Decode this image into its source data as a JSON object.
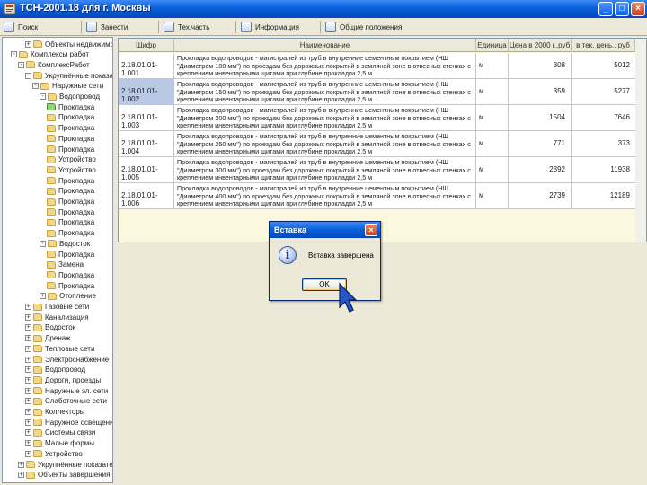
{
  "window": {
    "title": "ТСН-2001.18 для г. Москвы",
    "minimize": "_",
    "maximize": "□",
    "close": "×"
  },
  "toolbar": {
    "buttons": [
      "Поиск",
      "Занести",
      "Тех.часть",
      "Информация",
      "Общие положения"
    ]
  },
  "tree": {
    "items": [
      {
        "exp": "+",
        "label": "Объекты недвижимости"
      },
      {
        "exp": "-",
        "label": "Комплексы работ"
      },
      {
        "exp": "-",
        "label": "КомплексРабот"
      },
      {
        "exp": "-",
        "label": "Укрупнённые показатели"
      },
      {
        "exp": "-",
        "label": "Наружные сети"
      },
      {
        "exp": "-",
        "label": "Водопровод"
      },
      {
        "exp": "",
        "label": "Прокладка"
      },
      {
        "exp": "",
        "label": "Прокладка"
      },
      {
        "exp": "",
        "label": "Прокладка"
      },
      {
        "exp": "",
        "label": "Прокладка"
      },
      {
        "exp": "",
        "label": "Прокладка"
      },
      {
        "exp": "",
        "label": "Устройство"
      },
      {
        "exp": "",
        "label": "Устройство"
      },
      {
        "exp": "",
        "label": "Прокладка"
      },
      {
        "exp": "",
        "label": "Прокладка"
      },
      {
        "exp": "",
        "label": "Прокладка"
      },
      {
        "exp": "",
        "label": "Прокладка"
      },
      {
        "exp": "",
        "label": "Прокладка"
      },
      {
        "exp": "",
        "label": "Прокладка"
      },
      {
        "exp": "-",
        "label": "Водосток"
      },
      {
        "exp": "",
        "label": "Прокладка"
      },
      {
        "exp": "",
        "label": "Замена"
      },
      {
        "exp": "",
        "label": "Прокладка"
      },
      {
        "exp": "",
        "label": "Прокладка"
      },
      {
        "exp": "+",
        "label": "Отопление"
      },
      {
        "exp": "+",
        "label": "Газовые сети"
      },
      {
        "exp": "+",
        "label": "Канализация"
      },
      {
        "exp": "+",
        "label": "Водосток"
      },
      {
        "exp": "+",
        "label": "Дренаж"
      },
      {
        "exp": "+",
        "label": "Тепловые сети"
      },
      {
        "exp": "+",
        "label": "Электроснабжение"
      },
      {
        "exp": "+",
        "label": "Водопровод"
      },
      {
        "exp": "+",
        "label": "Дороги, проезды"
      },
      {
        "exp": "+",
        "label": "Наружные эл. сети"
      },
      {
        "exp": "+",
        "label": "Слаботочные сети"
      },
      {
        "exp": "+",
        "label": "Коллекторы"
      },
      {
        "exp": "+",
        "label": "Наружное освещение"
      },
      {
        "exp": "+",
        "label": "Системы связи"
      },
      {
        "exp": "+",
        "label": "Малые формы"
      },
      {
        "exp": "+",
        "label": "Устройство"
      },
      {
        "exp": "+",
        "label": "Укрупнённые показатели"
      },
      {
        "exp": "+",
        "label": "Объекты завершения"
      }
    ]
  },
  "grid": {
    "columns": [
      "Шифр",
      "Наименование",
      "Единица",
      "Цена в 2000 г.,руб",
      "в тек. цень., руб"
    ],
    "rows": [
      {
        "code": "2.18.01.01-1.001",
        "name": "Прокладка водопроводов - магистралей из труб в внутренние цементным покрытием (НШ \"Диаметром 100 мм\") по проездам без дорожных покрытий в земляной зоне в отвесных стенках с креплением инвентарными щитами при глубине прокладки 2,5 м",
        "unit": "м",
        "p2000": "308",
        "pcur": "5012",
        "sel": false
      },
      {
        "code": "2.18.01.01-1.002",
        "name": "Прокладка водопроводов - магистралей из труб в внутренние цементным покрытием (НШ \"Диаметром 150 мм\") по проездам без дорожных покрытий в земляной зоне в отвесных стенках с креплением инвентарными щитами при глубине прокладки 2,5 м",
        "unit": "м",
        "p2000": "359",
        "pcur": "5277",
        "sel": true
      },
      {
        "code": "2.18.01.01-1.003",
        "name": "Прокладка водопроводов - магистралей из труб в внутренние цементным покрытием (НШ \"Диаметром 200 мм\") по проездам без дорожных покрытий в земляной зоне в отвесных стенках с креплением инвентарными щитами при глубине прокладки 2,5 м",
        "unit": "м",
        "p2000": "1504",
        "pcur": "7646",
        "sel": false
      },
      {
        "code": "2.18.01.01-1.004",
        "name": "Прокладка водопроводов - магистралей из труб в внутренние цементным покрытием (НШ \"Диаметром 250 мм\") по проездам без дорожных покрытий в земляной зоне в отвесных стенках с креплением инвентарными щитами при глубине прокладки 2,5 м",
        "unit": "м",
        "p2000": "771",
        "pcur": "373",
        "sel": false
      },
      {
        "code": "2.18.01.01-1.005",
        "name": "Прокладка водопроводов - магистралей из труб в внутренние цементным покрытием (НШ \"Диаметром 300 мм\") по проездам без дорожных покрытий в земляной зоне в отвесных стенках с креплением инвентарными щитами при глубине прокладки 2,5 м",
        "unit": "м",
        "p2000": "2392",
        "pcur": "11938",
        "sel": false
      },
      {
        "code": "2.18.01.01-1.006",
        "name": "Прокладка водопроводов - магистралей из труб в внутренние цементным покрытием (НШ \"Диаметром 400 мм\") по проездам без дорожных покрытий в земляной зоне в отвесных стенках с креплением инвентарными щитами при глубине прокладки 2,5 м",
        "unit": "м",
        "p2000": "2739",
        "pcur": "12189",
        "sel": false
      }
    ]
  },
  "dialog": {
    "title": "Вставка",
    "close": "×",
    "icon": "info-icon",
    "icon_glyph": "i",
    "message": "Вставка завершена",
    "ok": "OK"
  },
  "colors": {
    "accent": "#0a5fd8",
    "selection": "#b9c8e4",
    "grid_bg": "#fbf8df"
  }
}
